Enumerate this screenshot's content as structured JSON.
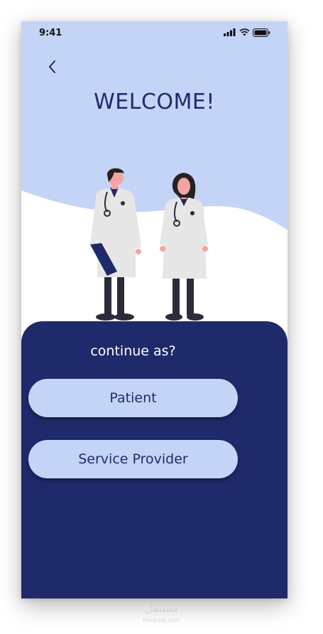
{
  "status_bar": {
    "time": "9:41"
  },
  "header": {
    "back_icon": "chevron-left-icon",
    "title": "WELCOME!"
  },
  "main": {
    "prompt": "continue as?",
    "options": [
      {
        "label": "Patient"
      },
      {
        "label": "Service Provider"
      }
    ]
  },
  "watermark": {
    "brand": "مستقل",
    "url": "mostaql.com"
  },
  "colors": {
    "primary_dark": "#1f2a6b",
    "light_blue": "#c4d4f7",
    "white": "#ffffff"
  }
}
